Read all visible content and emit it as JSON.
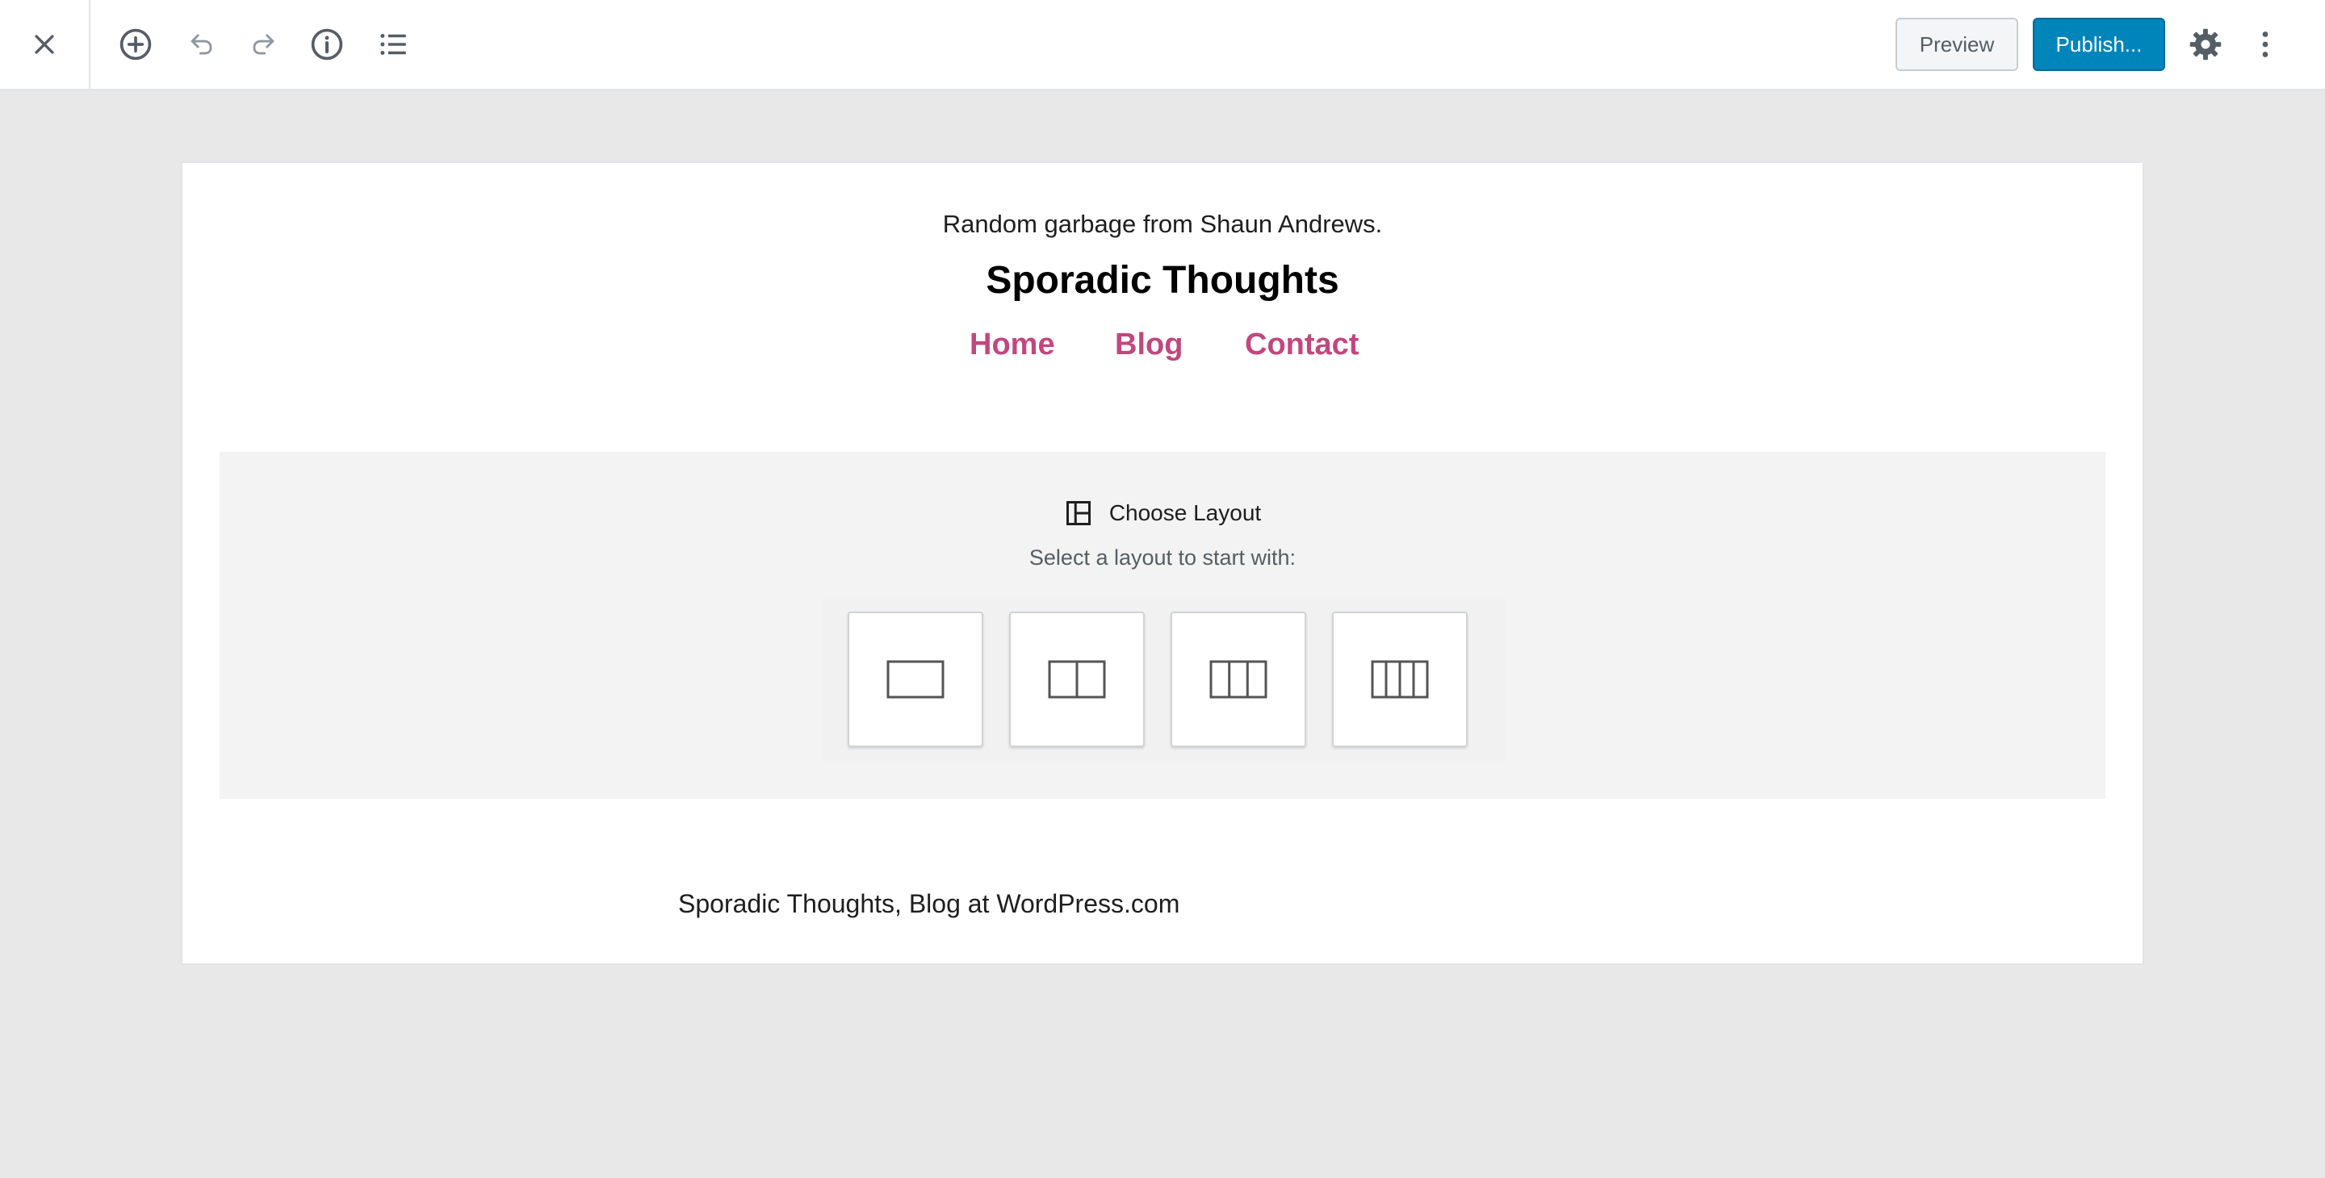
{
  "toolbar": {
    "close_icon": "close-icon",
    "tools": [
      {
        "name": "add-block",
        "icon": "plus-circle-icon"
      },
      {
        "name": "undo",
        "icon": "undo-icon"
      },
      {
        "name": "redo",
        "icon": "redo-icon"
      },
      {
        "name": "info",
        "icon": "info-icon"
      },
      {
        "name": "block-navigation",
        "icon": "list-icon"
      }
    ],
    "preview_label": "Preview",
    "publish_label": "Publish...",
    "settings_icon": "gear-icon",
    "more_icon": "more-vertical-icon"
  },
  "site": {
    "tagline": "Random garbage from Shaun Andrews.",
    "title": "Sporadic Thoughts",
    "nav": [
      "Home",
      "Blog",
      "Contact"
    ],
    "footer": "Sporadic Thoughts, Blog at WordPress.com"
  },
  "layout_picker": {
    "icon": "layout-icon",
    "title": "Choose Layout",
    "subtitle": "Select a layout to start with:",
    "options": [
      {
        "columns": 1,
        "icon": "one-column-icon"
      },
      {
        "columns": 2,
        "icon": "two-columns-icon"
      },
      {
        "columns": 3,
        "icon": "three-columns-icon"
      },
      {
        "columns": 4,
        "icon": "four-columns-icon"
      }
    ]
  },
  "colors": {
    "accent": "#0085ba",
    "nav_link": "#c2477e",
    "background": "#e8e8e8"
  }
}
